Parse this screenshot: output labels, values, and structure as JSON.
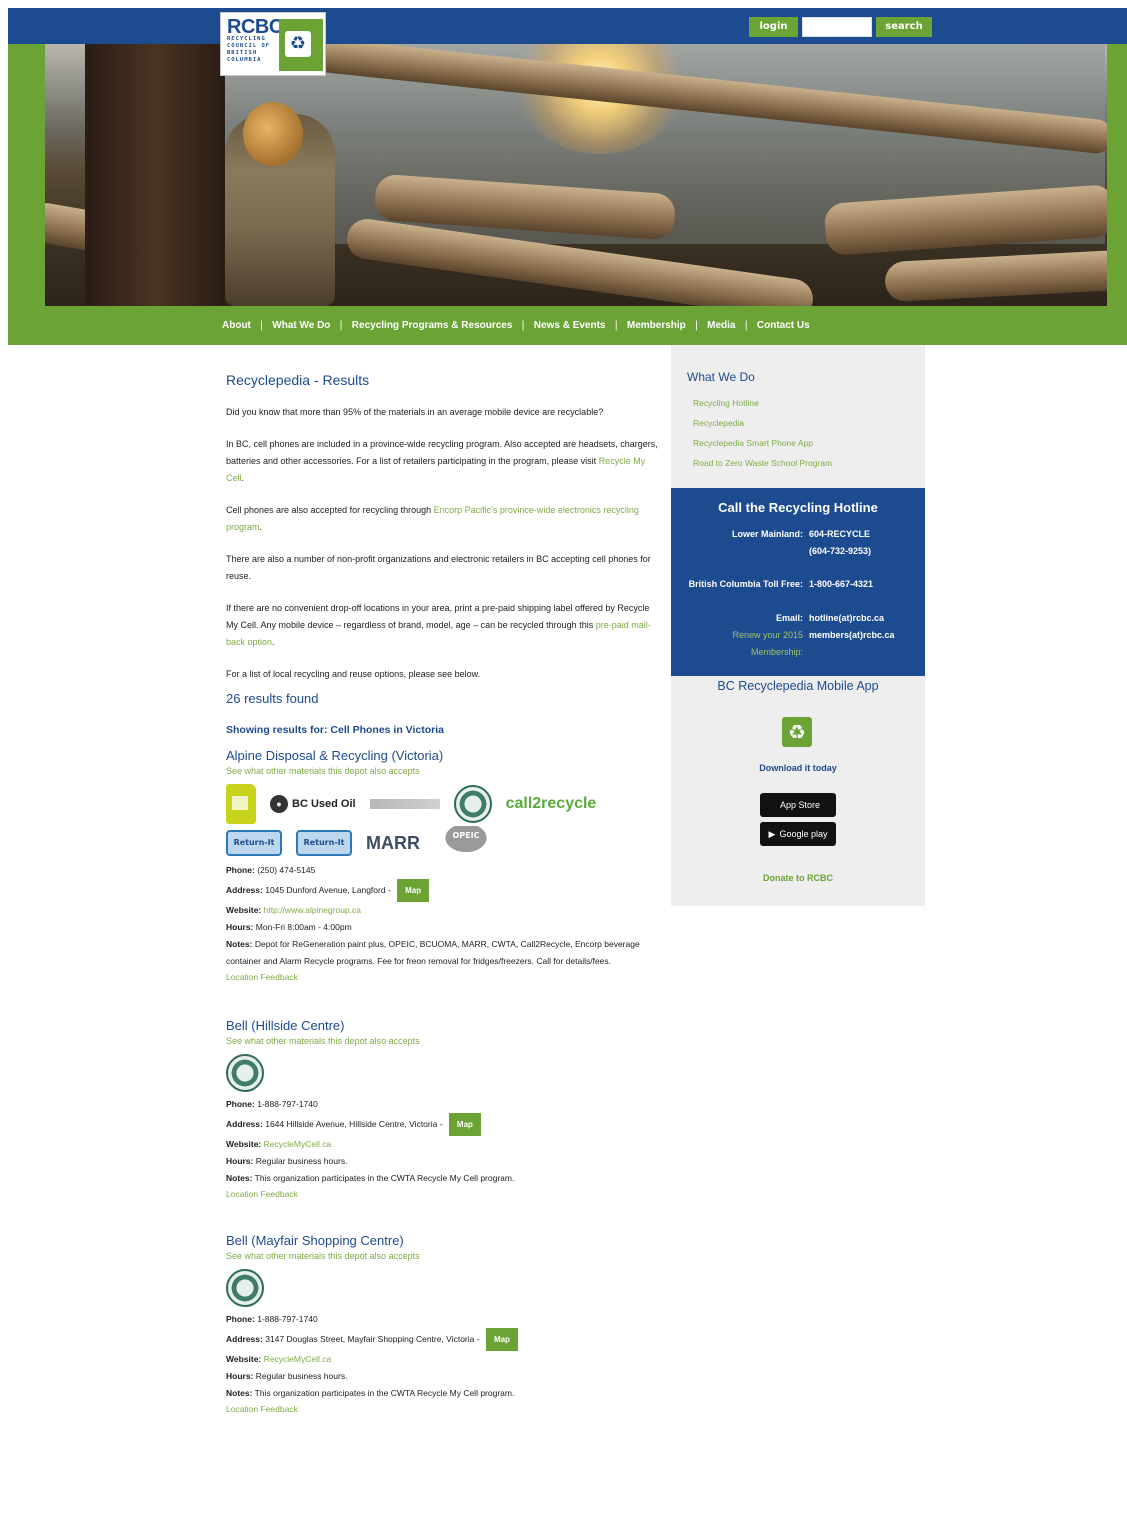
{
  "header": {
    "logo_text": "RCBC",
    "logo_sub": [
      "RECYCLING",
      "COUNCIL OF",
      "BRITISH",
      "COLUMBIA"
    ],
    "login_label": "login",
    "search_placeholder": "",
    "search_label": "search"
  },
  "nav": {
    "items": [
      "About",
      "What We Do",
      "Recycling Programs & Resources",
      "News & Events",
      "Membership",
      "Media",
      "Contact Us"
    ],
    "separator": "|"
  },
  "main": {
    "title": "Recyclepedia - Results",
    "p1": "Did you know that more than 95% of the materials in an average mobile device are recyclable?",
    "p2_text": "In BC, cell phones are included in a province-wide recycling program. Also accepted are headsets, chargers, batteries and other accessories. For a list of retailers participating in the program, please visit ",
    "p2_link": "Recycle My Cell",
    "p2_end": ".",
    "p3_text": "Cell phones are also accepted for recycling through ",
    "p3_link": "Encorp Pacific's province-wide electronics recycling program",
    "p3_end": ".",
    "p4": "There are also a number of non-profit organizations and electronic retailers in BC accepting cell phones for reuse.",
    "p5_text": "If there are no convenient drop-off locations in your area, print a pre-paid shipping label offered by Recycle My Cell. Any mobile device – regardless of brand, model, age – can be recycled through this ",
    "p5_link": "pre-paid mail-back option",
    "p5_end": ".",
    "p6": "For a list of local recycling and reuse options, please see below.",
    "results_count": "26 results found",
    "showing": "Showing results for: Cell Phones in Victoria"
  },
  "labels": {
    "also_accepts": "See what other materials this depot also accepts",
    "phone": "Phone:",
    "address": "Address:",
    "website": "Website:",
    "hours": "Hours:",
    "notes": "Notes:",
    "map": "Map",
    "feedback": "Location Feedback"
  },
  "depots": [
    {
      "name": "Alpine Disposal & Recycling (Victoria)",
      "phone": "(250) 474-5145",
      "address": "1045 Dunford Avenue, Langford - ",
      "website": "http://www.alpinegroup.ca",
      "hours": "Mon-Fri 8:00am - 4:00pm",
      "notes": "Depot for ReGeneration paint plus, OPEIC, BCUOMA, MARR, CWTA, Call2Recycle, Encorp beverage container and Alarm Recycle programs. Fee for freon removal for fridges/freezers. Call for details/fees.",
      "logo_labels": {
        "oil": "BC Used Oil",
        "call2": "call2recycle",
        "return1": "Return-It",
        "return2": "Return-It",
        "marr": "MARR",
        "opeic": "OPEIC"
      }
    },
    {
      "name": "Bell (Hillside Centre)",
      "phone": "1-888-797-1740",
      "address": "1644 Hillside Avenue, Hillside Centre, Victoria - ",
      "website": "RecycleMyCell.ca",
      "hours": "Regular business hours.",
      "notes": "This organization participates in the CWTA Recycle My Cell program."
    },
    {
      "name": "Bell (Mayfair Shopping Centre)",
      "phone": "1-888-797-1740",
      "address": "3147 Douglas Street, Mayfair Shopping Centre, Victoria - ",
      "website": "RecycleMyCell.ca",
      "hours": "Regular business hours.",
      "notes": "This organization participates in the CWTA Recycle My Cell program."
    }
  ],
  "sidebar": {
    "title": "What We Do",
    "links": [
      "Recycling Hotline",
      "Recyclepedia",
      "Recyclepedia Smart Phone App",
      "Road to Zero Waste School Program"
    ],
    "hotline": {
      "title": "Call the Recycling Hotline",
      "lower_mainland_label": "Lower Mainland:",
      "lower_mainland_value": "604-RECYCLE",
      "lower_mainland_value2": "(604-732-9253)",
      "toll_label": "British Columbia Toll Free:",
      "toll_value": "1-800-667-4321",
      "email_label": "Email:",
      "email_value": "hotline(at)rcbc.ca",
      "renew_label": "Renew your 2015 Membership:",
      "renew_value": "members(at)rcbc.ca"
    },
    "app_title": "BC Recyclepedia Mobile App",
    "download": "Download it today",
    "app_store": "App Store",
    "google_play": "Google play",
    "donate": "Donate to RCBC"
  }
}
